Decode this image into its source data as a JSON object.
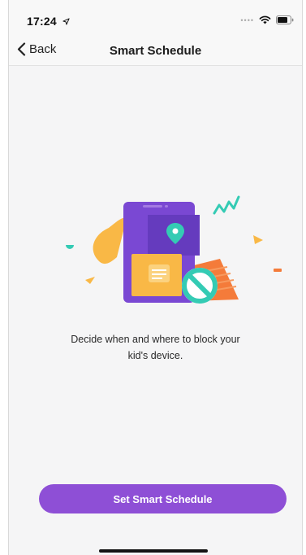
{
  "status_bar": {
    "time": "17:24",
    "location_icon": "location-arrow-icon",
    "wifi_icon": "wifi-icon",
    "battery_icon": "battery-icon"
  },
  "nav": {
    "back_label": "Back",
    "title": "Smart Schedule"
  },
  "main": {
    "illustration": "phone-schedule-block-illustration",
    "caption_line1": "Decide when and where to block your",
    "caption_line2": "kid's device."
  },
  "cta": {
    "label": "Set Smart Schedule"
  },
  "colors": {
    "accent": "#8e4fd6",
    "phone": "#7a48d3",
    "yellow": "#f9b846",
    "teal": "#34cbb4",
    "orange": "#f47b3a"
  }
}
